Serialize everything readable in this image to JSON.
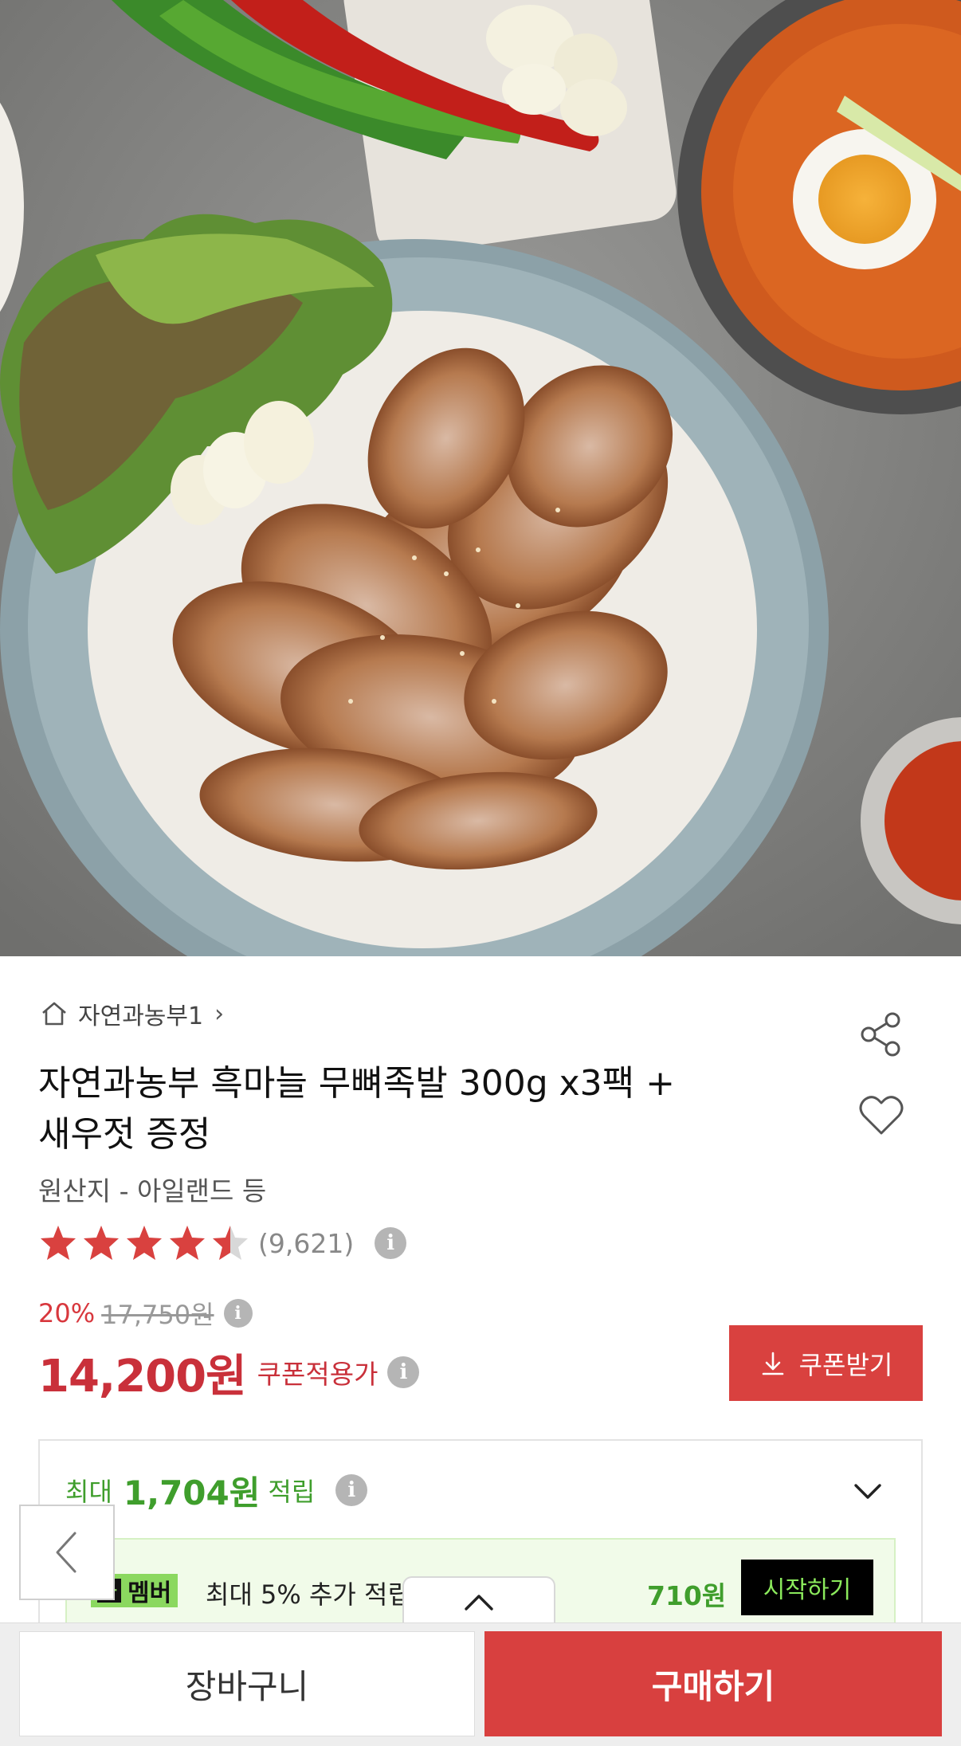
{
  "product_image": {
    "alt": ""
  },
  "breadcrumb": {
    "icon": "home-icon",
    "label": "자연과농부1",
    "chevron": "›"
  },
  "actions": {
    "share_icon": "share-icon",
    "wishlist_icon": "heart-icon"
  },
  "product": {
    "title_line1": "자연과농부 흑마늘 무뼈족발 300g x3팩 +",
    "title_line2": "새우젓 증정",
    "origin": "원산지 - 아일랜드 등"
  },
  "rating": {
    "score": 4.5,
    "max": 5,
    "review_count": "(9,621)",
    "star_color": "#d9413f",
    "info_icon": "i"
  },
  "pricing": {
    "discount_rate": "20%",
    "original_price": "17,750원",
    "sale_price": "14,200원",
    "coupon_label": "쿠폰적용가",
    "info_icon": "i",
    "accent_color": "#c9303a"
  },
  "coupon_button": {
    "label": "쿠폰받기",
    "icon": "download-icon"
  },
  "points": {
    "prefix": "최대",
    "amount": "1,704원",
    "suffix": "적립",
    "info_icon": "i",
    "color": "#3f9e2c"
  },
  "membership": {
    "badge_mark": "쿠",
    "badge_text": "멤버",
    "description": "최대 5% 추가 적립",
    "amount": "710원",
    "start_label": "시작하기"
  },
  "bottom_bar": {
    "cart_label": "장바구니",
    "buy_label": "구매하기",
    "buy_color": "#d8403f"
  }
}
